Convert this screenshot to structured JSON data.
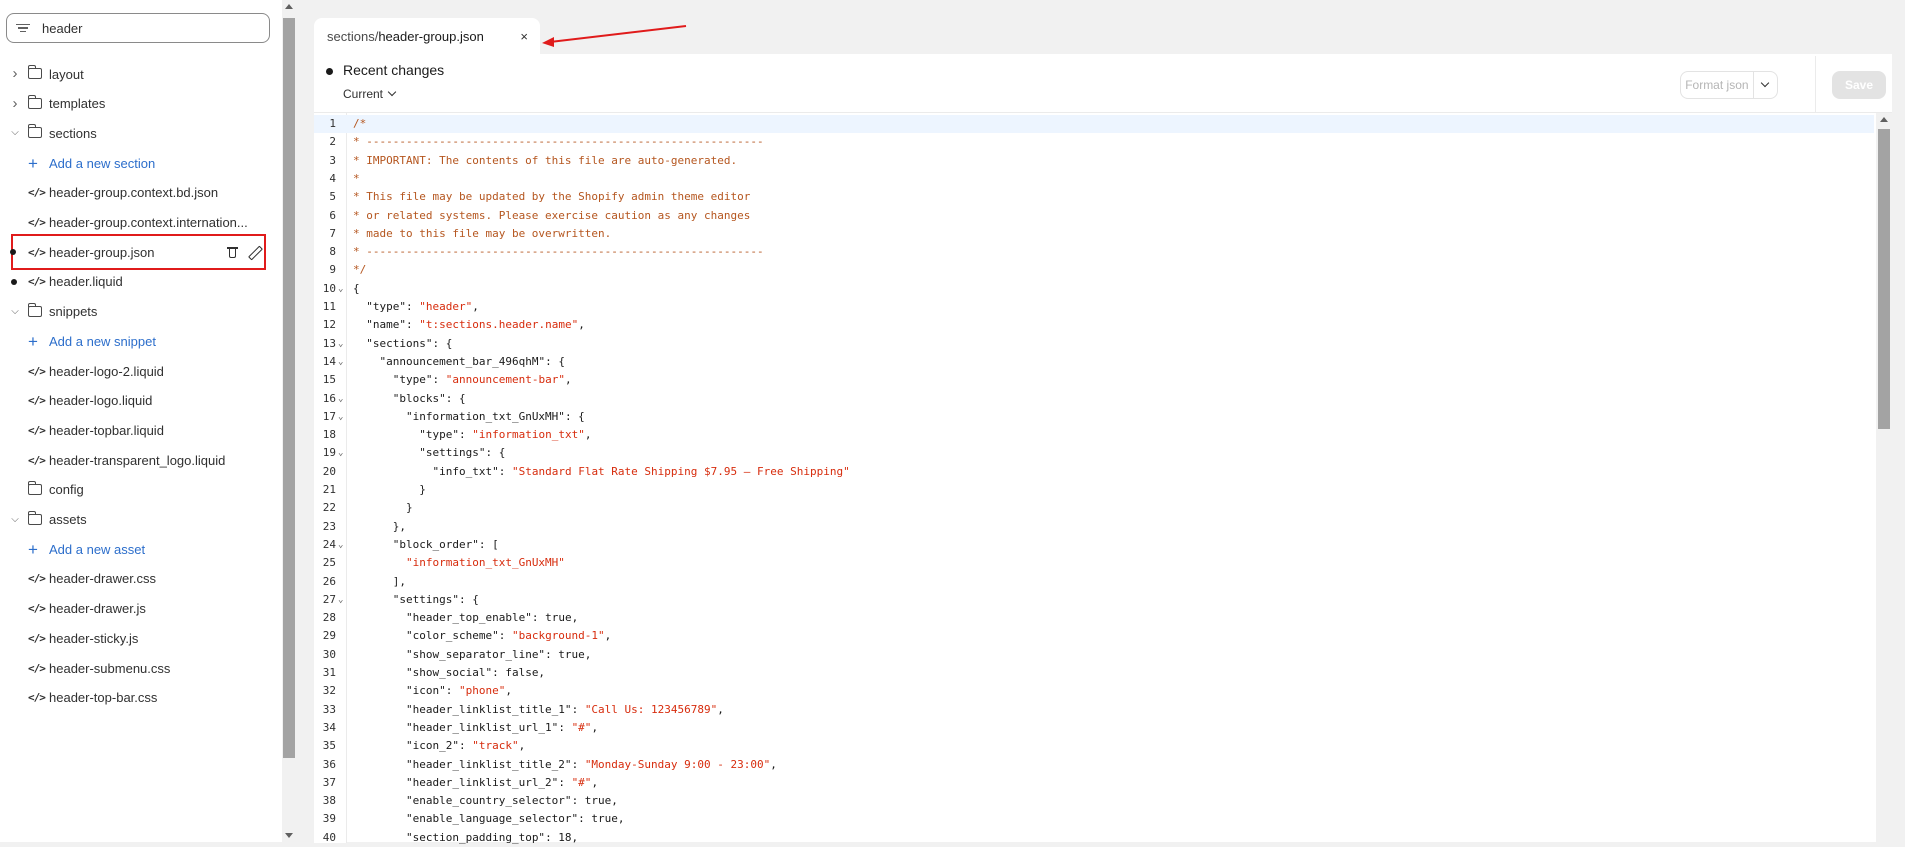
{
  "search": {
    "value": "header",
    "icon": "filter-icon"
  },
  "tree": [
    {
      "kind": "folder",
      "label": "layout",
      "expanded": false
    },
    {
      "kind": "folder",
      "label": "templates",
      "expanded": false
    },
    {
      "kind": "folder",
      "label": "sections",
      "expanded": true
    },
    {
      "kind": "add",
      "label": "Add a new section"
    },
    {
      "kind": "file",
      "label": "header-group.context.bd.json"
    },
    {
      "kind": "file",
      "label": "header-group.context.internation..."
    },
    {
      "kind": "file",
      "label": "header-group.json",
      "selected": true,
      "modified": true
    },
    {
      "kind": "file",
      "label": "header.liquid",
      "modified": true
    },
    {
      "kind": "folder",
      "label": "snippets",
      "expanded": true
    },
    {
      "kind": "add",
      "label": "Add a new snippet"
    },
    {
      "kind": "file",
      "label": "header-logo-2.liquid"
    },
    {
      "kind": "file",
      "label": "header-logo.liquid"
    },
    {
      "kind": "file",
      "label": "header-topbar.liquid"
    },
    {
      "kind": "file",
      "label": "header-transparent_logo.liquid"
    },
    {
      "kind": "folder",
      "label": "config",
      "expanded": false,
      "nochevron": true
    },
    {
      "kind": "folder",
      "label": "assets",
      "expanded": true
    },
    {
      "kind": "add",
      "label": "Add a new asset"
    },
    {
      "kind": "file",
      "label": "header-drawer.css"
    },
    {
      "kind": "file",
      "label": "header-drawer.js"
    },
    {
      "kind": "file",
      "label": "header-sticky.js"
    },
    {
      "kind": "file",
      "label": "header-submenu.css"
    },
    {
      "kind": "file",
      "label": "header-top-bar.css"
    }
  ],
  "tab": {
    "prefix": "sections/",
    "name": "header-group.json",
    "close": "×"
  },
  "editor": {
    "recent_changes": "Recent changes",
    "current": "Current",
    "format_button": "Format json",
    "save_button": "Save",
    "accent": "#e01b1b"
  },
  "code_lines": [
    "/*",
    "* ------------------------------------------------------------",
    "* IMPORTANT: The contents of this file are auto-generated.",
    "*",
    "* This file may be updated by the Shopify admin theme editor",
    "* or related systems. Please exercise caution as any changes",
    "* made to this file may be overwritten.",
    "* ------------------------------------------------------------",
    "*/",
    "{",
    "  \"type\": \"header\",",
    "  \"name\": \"t:sections.header.name\",",
    "  \"sections\": {",
    "    \"announcement_bar_496qhM\": {",
    "      \"type\": \"announcement-bar\",",
    "      \"blocks\": {",
    "        \"information_txt_GnUxMH\": {",
    "          \"type\": \"information_txt\",",
    "          \"settings\": {",
    "            \"info_txt\": \"Standard Flat Rate Shipping $7.95 – Free Shipping\"",
    "          }",
    "        }",
    "      },",
    "      \"block_order\": [",
    "        \"information_txt_GnUxMH\"",
    "      ],",
    "      \"settings\": {",
    "        \"header_top_enable\": true,",
    "        \"color_scheme\": \"background-1\",",
    "        \"show_separator_line\": true,",
    "        \"show_social\": false,",
    "        \"icon\": \"phone\",",
    "        \"header_linklist_title_1\": \"Call Us: 123456789\",",
    "        \"header_linklist_url_1\": \"#\",",
    "        \"icon_2\": \"track\",",
    "        \"header_linklist_title_2\": \"Monday-Sunday 9:00 - 23:00\",",
    "        \"header_linklist_url_2\": \"#\",",
    "        \"enable_country_selector\": true,",
    "        \"enable_language_selector\": true,",
    "        \"section_padding_top\": 18,"
  ],
  "fold_lines": [
    10,
    13,
    14,
    16,
    17,
    19,
    24,
    27
  ]
}
